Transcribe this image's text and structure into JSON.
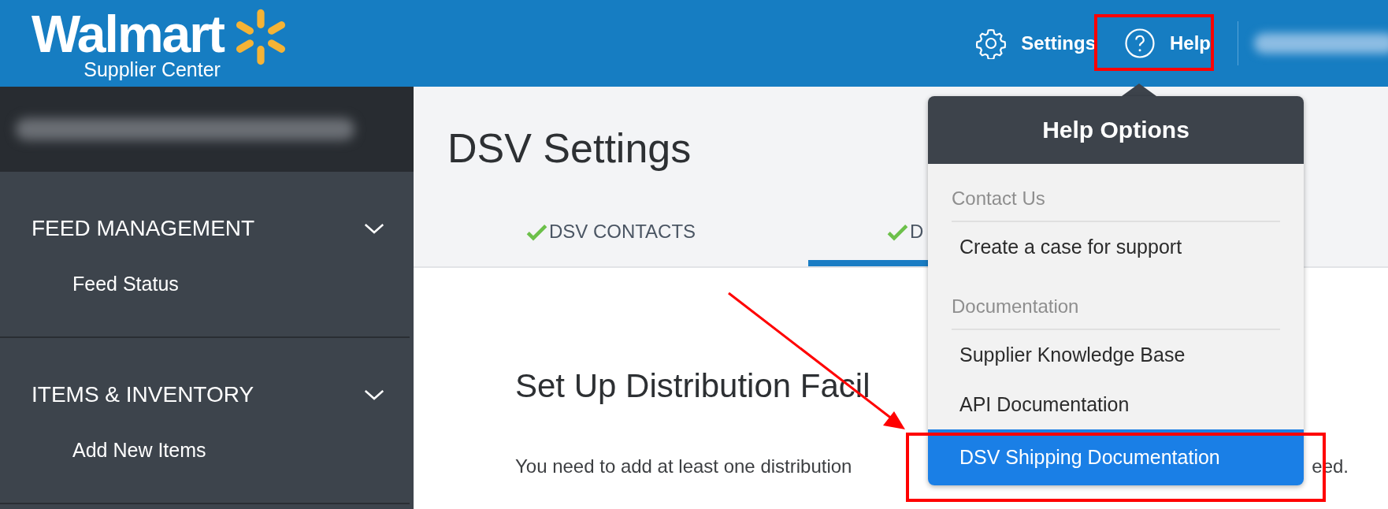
{
  "header": {
    "logo": {
      "wordmark": "Walmart",
      "subtitle": "Supplier Center"
    },
    "nav": [
      {
        "kind": "settings",
        "label": "Settings"
      },
      {
        "kind": "help",
        "label": "Help",
        "expanded": true
      }
    ]
  },
  "sidebar": {
    "sections": [
      {
        "label": "FEED MANAGEMENT",
        "expanded": true,
        "children": [
          {
            "label": "Feed Status"
          }
        ]
      },
      {
        "label": "ITEMS & INVENTORY",
        "expanded": true,
        "children": [
          {
            "label": "Add New Items"
          }
        ]
      }
    ]
  },
  "page": {
    "title": "DSV Settings",
    "tabs": [
      {
        "label": "DSV CONTACTS",
        "complete": true,
        "selected": false
      },
      {
        "label": "D",
        "complete": true,
        "selected": true
      }
    ],
    "heading": "Set Up Distribution Facil",
    "text_start": "You need to add at least one distribution",
    "text_end": "eed."
  },
  "help_menu": {
    "title": "Help Options",
    "groups": [
      {
        "heading": "Contact Us",
        "items": [
          {
            "label": "Create a case for support",
            "selected": false
          }
        ]
      },
      {
        "heading": "Documentation",
        "items": [
          {
            "label": "Supplier Knowledge Base",
            "selected": false
          },
          {
            "label": "API Documentation",
            "selected": false
          },
          {
            "label": "DSV Shipping Documentation",
            "selected": true
          }
        ]
      }
    ]
  }
}
